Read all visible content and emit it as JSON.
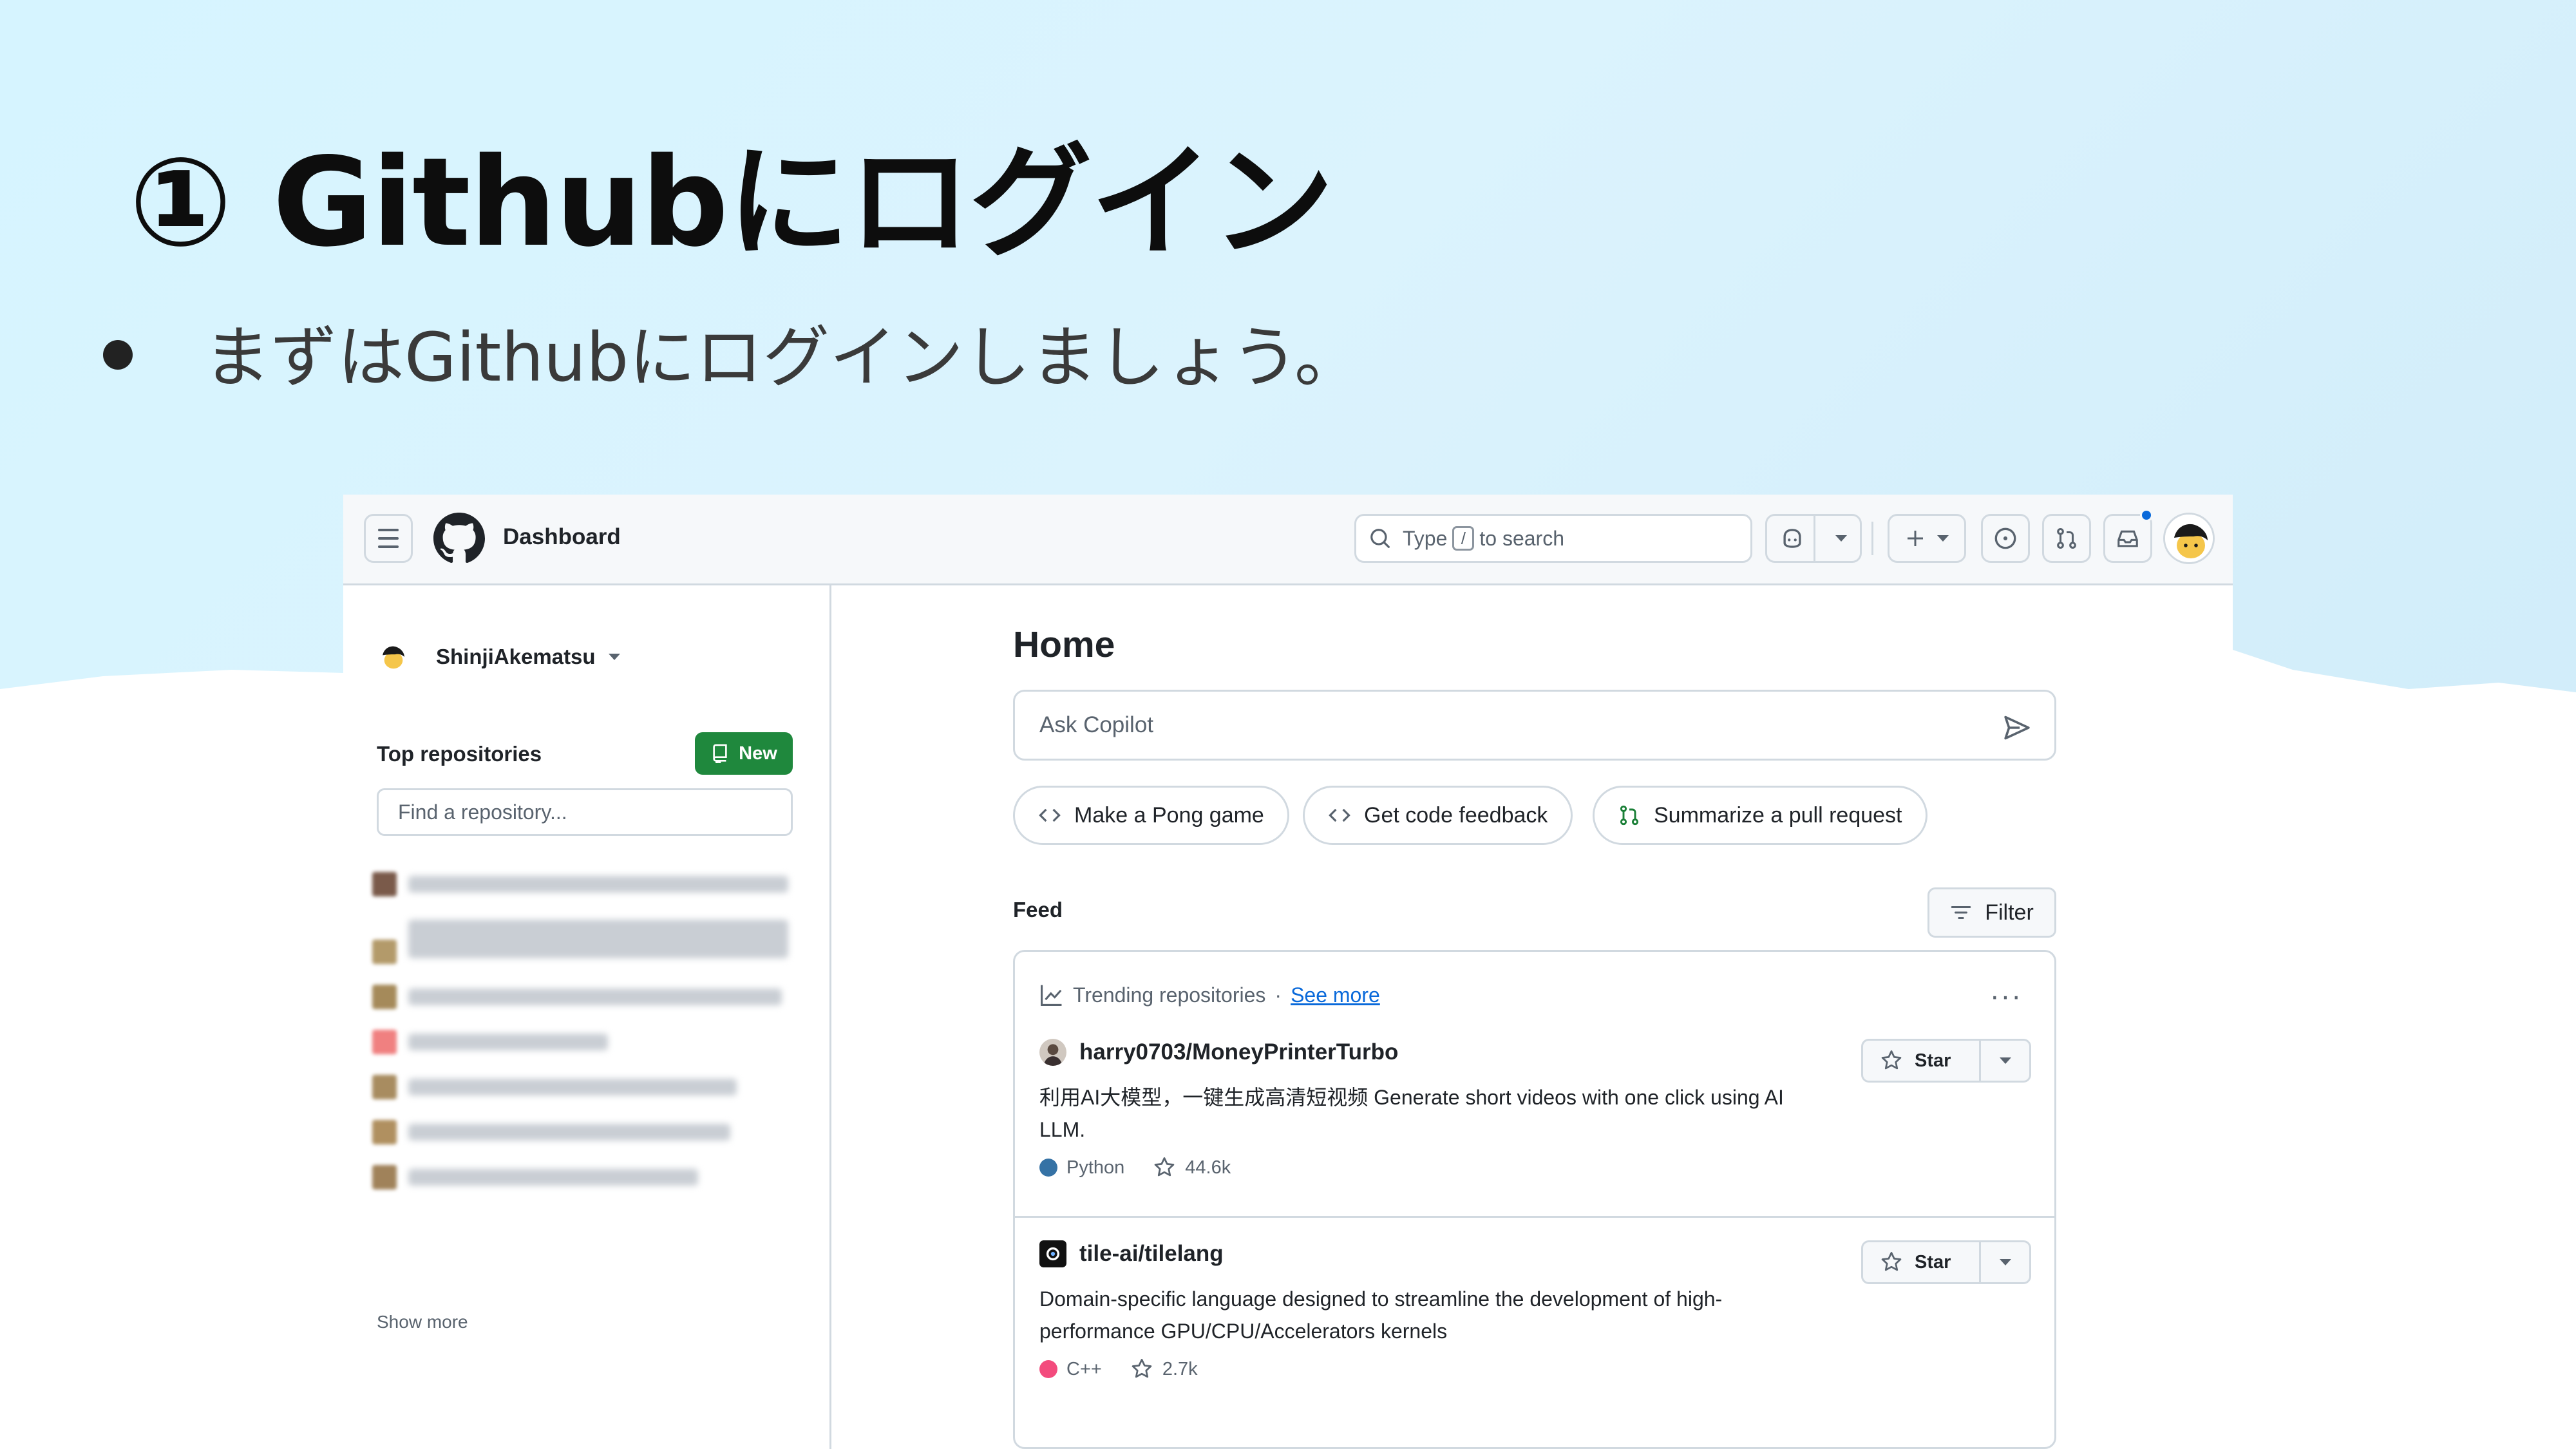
{
  "slide": {
    "title": "① Githubにログイン",
    "bullet": "まずはGithubにログインしましょう。"
  },
  "header": {
    "page_label": "Dashboard",
    "search_prefix": "Type",
    "search_key": "/",
    "search_suffix": "to search"
  },
  "sidebar": {
    "username": "ShinjiAkematsu",
    "top_repos_label": "Top repositories",
    "new_label": "New",
    "find_placeholder": "Find a repository...",
    "show_more": "Show more"
  },
  "main": {
    "title": "Home",
    "ask_placeholder": "Ask Copilot",
    "chips": [
      "Make a Pong game",
      "Get code feedback",
      "Summarize a pull request"
    ],
    "feed_label": "Feed",
    "filter_label": "Filter",
    "trending_label": "Trending repositories",
    "trending_sep": "·",
    "see_more": "See more",
    "more_dots": "···",
    "star_label": "Star",
    "repos": [
      {
        "name": "harry0703/MoneyPrinterTurbo",
        "description": "利用AI大模型，一键生成高清短视频 Generate short videos with one click using AI LLM.",
        "language": "Python",
        "language_color": "#3572A5",
        "stars": "44.6k"
      },
      {
        "name": "tile-ai/tilelang",
        "description": "Domain-specific language designed to streamline the development of high-performance GPU/CPU/Accelerators kernels",
        "language": "C++",
        "language_color": "#f34b7d",
        "stars": "2.7k"
      }
    ]
  },
  "colors": {
    "accent": "#0969da",
    "new_button": "#1f883d",
    "notification": "#0969da"
  }
}
